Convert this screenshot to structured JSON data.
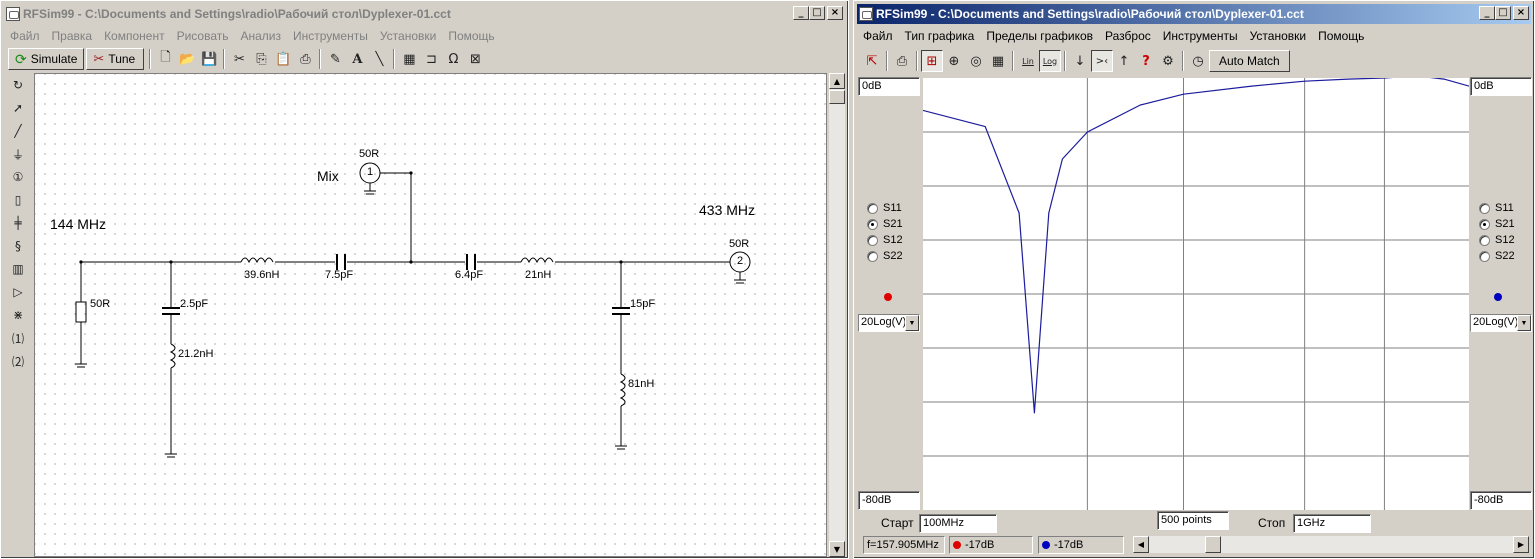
{
  "schematic_window": {
    "title": "RFSim99 - C:\\Documents and Settings\\radio\\Рабочий стол\\Dyplexer-01.cct",
    "menu": [
      "Файл",
      "Правка",
      "Компонент",
      "Рисовать",
      "Анализ",
      "Инструменты",
      "Установки",
      "Помощь"
    ],
    "toolbar": {
      "simulate_label": "Simulate",
      "tune_label": "Tune"
    },
    "window_buttons": {
      "minimize": "_",
      "maximize": "□",
      "close": "×"
    },
    "schematic": {
      "label_144": "144 MHz",
      "label_433": "433 MHz",
      "label_mix": "Mix",
      "port1_impedance": "50R",
      "port1_number": "1",
      "port2_impedance": "50R",
      "port2_number": "2",
      "resistor_value": "50R",
      "c1_value": "2.5pF",
      "l1_value": "21.2nH",
      "l2_value": "39.6nH",
      "c2_value": "7.5pF",
      "c3_value": "6.4pF",
      "l3_value": "21nH",
      "c4_value": "15pF",
      "l4_value": "81nH"
    }
  },
  "graph_window": {
    "title": "RFSim99 - C:\\Documents and Settings\\radio\\Рабочий стол\\Dyplexer-01.cct",
    "menu": [
      "Файл",
      "Тип графика",
      "Пределы графиков",
      "Разброс",
      "Инструменты",
      "Установки",
      "Помощь"
    ],
    "toolbar": {
      "lin_label": "Lin",
      "log_label": "Log",
      "auto_match_label": "Auto Match"
    },
    "left_axis": {
      "top": "0dB",
      "bottom": "-80dB",
      "mode": "20Log(V)",
      "marker_color": "#e00000",
      "params": [
        "S11",
        "S21",
        "S12",
        "S22"
      ],
      "selected": "S21"
    },
    "right_axis": {
      "top": "0dB",
      "bottom": "-80dB",
      "mode": "20Log(V)",
      "marker_color": "#0000c0",
      "params": [
        "S11",
        "S21",
        "S12",
        "S22"
      ],
      "selected": "S21"
    },
    "sweep": {
      "start_label": "Старт",
      "start_value": "100MHz",
      "points": "500 points",
      "stop_label": "Стоп",
      "stop_value": "1GHz"
    },
    "status": {
      "frequency": "f=157.905MHz",
      "left_readout": "-17dB",
      "right_readout": "-17dB"
    },
    "trace_color": "#1c1c9c"
  },
  "chart_data": {
    "type": "line",
    "x": [
      100,
      130,
      150,
      160,
      170,
      180,
      200,
      250,
      300,
      400,
      500,
      600,
      700,
      800,
      900,
      1000
    ],
    "xlabel": "",
    "ylabel": "",
    "xlim": [
      100,
      1000
    ],
    "ylim": [
      -80,
      0
    ],
    "grid": true,
    "series": [
      {
        "values": [
          -6,
          -9,
          -25,
          -62,
          -25,
          -15,
          -10,
          -5,
          -3,
          -1.5,
          -0.6,
          -0.2,
          0,
          0.4,
          -0.2,
          -1.5
        ]
      }
    ]
  }
}
